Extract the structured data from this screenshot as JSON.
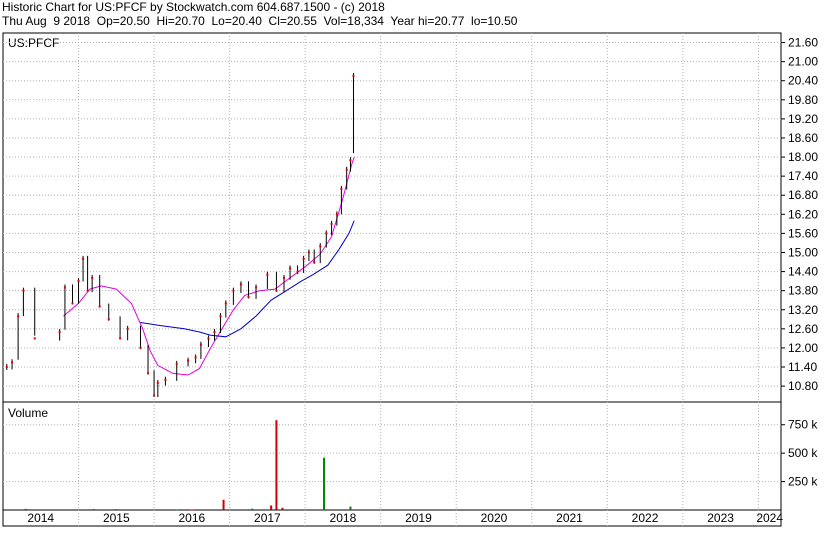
{
  "header": {
    "line1": "Historic Chart for US:PFCF by Stockwatch.com 604.687.1500 - (c) 2018",
    "line2": "Thu Aug  9 2018  Op=20.50  Hi=20.70  Lo=20.40  Cl=20.55  Vol=18,334  Year hi=20.77  lo=10.50"
  },
  "chart_data": [
    {
      "type": "line",
      "title": "US:PFCF",
      "y_ticks": [
        "21.60",
        "21.00",
        "20.40",
        "19.80",
        "19.20",
        "18.60",
        "18.00",
        "17.40",
        "16.80",
        "16.20",
        "15.60",
        "15.00",
        "14.40",
        "13.80",
        "13.20",
        "12.60",
        "12.00",
        "11.40",
        "10.80"
      ],
      "ylim": [
        10.3,
        21.9
      ],
      "x_ticks": [
        "2014",
        "2015",
        "2016",
        "2017",
        "2018",
        "2019",
        "2020",
        "2021",
        "2022",
        "2023",
        "2024"
      ],
      "xlim": [
        2014.0,
        2024.3
      ],
      "grid": true,
      "series": [
        {
          "kind": "price_bars",
          "color": "#000000",
          "points": [
            {
              "x": 2014.05,
              "y": 11.4
            },
            {
              "x": 2014.12,
              "y": 11.55
            },
            {
              "x": 2014.2,
              "y": 13.0
            },
            {
              "x": 2014.27,
              "y": 13.8
            },
            {
              "x": 2014.42,
              "y": 12.3
            },
            {
              "x": 2014.75,
              "y": 12.5
            },
            {
              "x": 2014.82,
              "y": 13.9
            },
            {
              "x": 2014.92,
              "y": 13.4
            },
            {
              "x": 2015.0,
              "y": 14.1
            },
            {
              "x": 2015.06,
              "y": 14.8
            },
            {
              "x": 2015.12,
              "y": 13.8
            },
            {
              "x": 2015.18,
              "y": 14.2
            },
            {
              "x": 2015.28,
              "y": 13.3
            },
            {
              "x": 2015.4,
              "y": 12.9
            },
            {
              "x": 2015.55,
              "y": 12.3
            },
            {
              "x": 2015.65,
              "y": 12.6
            },
            {
              "x": 2015.82,
              "y": 12.0
            },
            {
              "x": 2015.92,
              "y": 11.2
            },
            {
              "x": 2016.0,
              "y": 10.5
            },
            {
              "x": 2016.05,
              "y": 10.9
            },
            {
              "x": 2016.15,
              "y": 11.0
            },
            {
              "x": 2016.3,
              "y": 11.5
            },
            {
              "x": 2016.45,
              "y": 11.6
            },
            {
              "x": 2016.55,
              "y": 11.7
            },
            {
              "x": 2016.62,
              "y": 12.1
            },
            {
              "x": 2016.72,
              "y": 12.3
            },
            {
              "x": 2016.8,
              "y": 12.5
            },
            {
              "x": 2016.88,
              "y": 13.0
            },
            {
              "x": 2016.95,
              "y": 13.4
            },
            {
              "x": 2017.05,
              "y": 13.8
            },
            {
              "x": 2017.15,
              "y": 14.0
            },
            {
              "x": 2017.25,
              "y": 13.6
            },
            {
              "x": 2017.35,
              "y": 13.9
            },
            {
              "x": 2017.5,
              "y": 14.3
            },
            {
              "x": 2017.62,
              "y": 13.8
            },
            {
              "x": 2017.72,
              "y": 14.2
            },
            {
              "x": 2017.8,
              "y": 14.5
            },
            {
              "x": 2017.9,
              "y": 14.4
            },
            {
              "x": 2017.98,
              "y": 14.8
            },
            {
              "x": 2018.05,
              "y": 15.0
            },
            {
              "x": 2018.12,
              "y": 14.7
            },
            {
              "x": 2018.2,
              "y": 15.2
            },
            {
              "x": 2018.28,
              "y": 15.6
            },
            {
              "x": 2018.35,
              "y": 15.9
            },
            {
              "x": 2018.42,
              "y": 16.2
            },
            {
              "x": 2018.48,
              "y": 17.0
            },
            {
              "x": 2018.55,
              "y": 17.6
            },
            {
              "x": 2018.6,
              "y": 17.9
            },
            {
              "x": 2018.64,
              "y": 20.55
            }
          ]
        },
        {
          "kind": "moving_average_short",
          "color": "#e000e0",
          "points": [
            {
              "x": 2014.8,
              "y": 13.0
            },
            {
              "x": 2015.0,
              "y": 13.4
            },
            {
              "x": 2015.15,
              "y": 13.85
            },
            {
              "x": 2015.3,
              "y": 13.95
            },
            {
              "x": 2015.5,
              "y": 13.85
            },
            {
              "x": 2015.7,
              "y": 13.4
            },
            {
              "x": 2015.85,
              "y": 12.6
            },
            {
              "x": 2015.95,
              "y": 11.9
            },
            {
              "x": 2016.05,
              "y": 11.45
            },
            {
              "x": 2016.25,
              "y": 11.2
            },
            {
              "x": 2016.45,
              "y": 11.15
            },
            {
              "x": 2016.6,
              "y": 11.35
            },
            {
              "x": 2016.75,
              "y": 12.0
            },
            {
              "x": 2016.9,
              "y": 12.6
            },
            {
              "x": 2017.05,
              "y": 13.2
            },
            {
              "x": 2017.2,
              "y": 13.65
            },
            {
              "x": 2017.4,
              "y": 13.8
            },
            {
              "x": 2017.6,
              "y": 13.85
            },
            {
              "x": 2017.8,
              "y": 14.2
            },
            {
              "x": 2018.0,
              "y": 14.55
            },
            {
              "x": 2018.2,
              "y": 14.95
            },
            {
              "x": 2018.35,
              "y": 15.5
            },
            {
              "x": 2018.5,
              "y": 16.7
            },
            {
              "x": 2018.62,
              "y": 17.8
            },
            {
              "x": 2018.65,
              "y": 18.0
            }
          ]
        },
        {
          "kind": "moving_average_long",
          "color": "#0000cc",
          "points": [
            {
              "x": 2015.82,
              "y": 12.8
            },
            {
              "x": 2016.1,
              "y": 12.7
            },
            {
              "x": 2016.4,
              "y": 12.6
            },
            {
              "x": 2016.6,
              "y": 12.5
            },
            {
              "x": 2016.75,
              "y": 12.4
            },
            {
              "x": 2016.95,
              "y": 12.35
            },
            {
              "x": 2017.15,
              "y": 12.6
            },
            {
              "x": 2017.35,
              "y": 13.0
            },
            {
              "x": 2017.55,
              "y": 13.5
            },
            {
              "x": 2017.75,
              "y": 13.8
            },
            {
              "x": 2017.95,
              "y": 14.1
            },
            {
              "x": 2018.1,
              "y": 14.3
            },
            {
              "x": 2018.3,
              "y": 14.6
            },
            {
              "x": 2018.45,
              "y": 15.1
            },
            {
              "x": 2018.58,
              "y": 15.6
            },
            {
              "x": 2018.65,
              "y": 16.0
            }
          ]
        }
      ]
    },
    {
      "type": "bar",
      "title": "Volume",
      "y_ticks": [
        "750 k",
        "500 k",
        "250 k"
      ],
      "ylim": [
        0,
        950
      ],
      "grid": true,
      "series": [
        {
          "name": "",
          "color": "#cc0000",
          "points": [
            {
              "x": 2014.3,
              "y": 10
            },
            {
              "x": 2015.2,
              "y": 8
            },
            {
              "x": 2016.5,
              "y": 5
            },
            {
              "x": 2016.92,
              "y": 90
            },
            {
              "x": 2017.55,
              "y": 40
            },
            {
              "x": 2017.62,
              "y": 790
            },
            {
              "x": 2017.7,
              "y": 20
            }
          ]
        },
        {
          "name": "",
          "color": "#008800",
          "points": [
            {
              "x": 2015.5,
              "y": 8
            },
            {
              "x": 2016.3,
              "y": 6
            },
            {
              "x": 2017.3,
              "y": 12
            },
            {
              "x": 2018.25,
              "y": 460
            },
            {
              "x": 2018.6,
              "y": 30
            }
          ]
        }
      ]
    }
  ]
}
